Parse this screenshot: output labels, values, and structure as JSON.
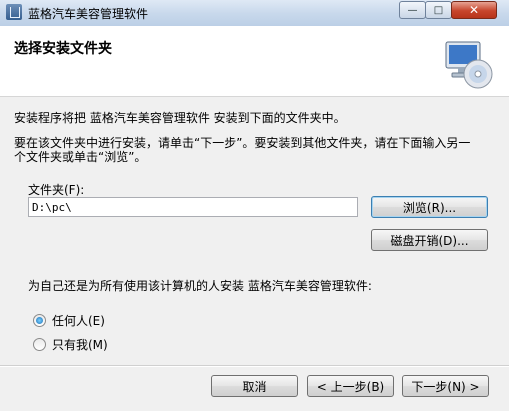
{
  "window": {
    "title": "蓝格汽车美容管理软件",
    "min_symbol": "—",
    "max_symbol": "□",
    "close_symbol": "✕"
  },
  "header": {
    "title": "选择安装文件夹",
    "icon": "cd-install-icon"
  },
  "body": {
    "line1": "安装程序将把 蓝格汽车美容管理软件 安装到下面的文件夹中。",
    "line2": "要在该文件夹中进行安装，请单击“下一步”。要安装到其他文件夹，请在下面输入另一",
    "line3": "个文件夹或单击“浏览”。"
  },
  "folder": {
    "label": "文件夹(F):",
    "value": "D:\\pc\\",
    "browse_label": "浏览(R)...",
    "disk_cost_label": "磁盘开销(D)..."
  },
  "install_for": {
    "question": "为自己还是为所有使用该计算机的人安装 蓝格汽车美容管理软件:",
    "options": [
      {
        "label": "任何人(E)",
        "selected": true
      },
      {
        "label": "只有我(M)",
        "selected": false
      }
    ]
  },
  "footer": {
    "cancel_label": "取消",
    "back_label": "< 上一步(B)",
    "next_label": "下一步(N) >"
  }
}
